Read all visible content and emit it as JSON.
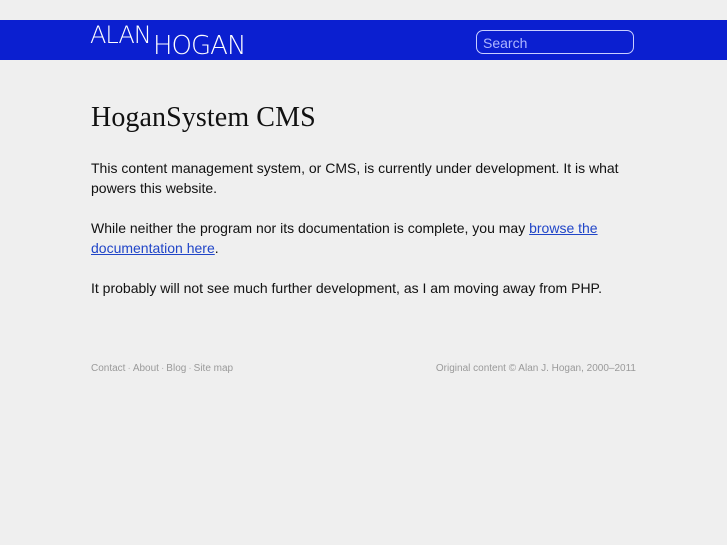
{
  "header": {
    "logo": {
      "word1": "ALAN",
      "word2": "HOGAN"
    },
    "search_placeholder": "Search",
    "search_value": ""
  },
  "main": {
    "title": "HoganSystem CMS",
    "paragraph1": "This content management system, or CMS, is currently under development. It is what powers this website.",
    "paragraph2_prefix": "While neither the program nor its documentation is complete, you may ",
    "paragraph2_link": "browse the documentation here",
    "paragraph2_suffix": ".",
    "paragraph3": "It probably will not see much further development, as I am moving away from PHP."
  },
  "footer": {
    "links": [
      "Contact",
      "About",
      "Blog",
      "Site map"
    ],
    "separator": "·",
    "copyright": "Original content © Alan J. Hogan, 2000–2011"
  },
  "colors": {
    "header_blue": "#0b1fd0",
    "page_background": "#efefef",
    "link_blue": "#2045c8",
    "footer_gray": "#9a9a9a"
  }
}
